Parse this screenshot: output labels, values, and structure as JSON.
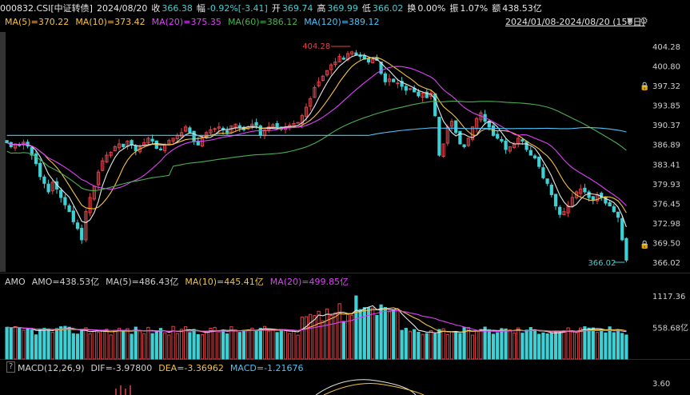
{
  "header": {
    "code": "000832.CSI[中证转债]",
    "date": "2024/08/20",
    "close_label": "收",
    "close": "366.38",
    "change_label": "幅",
    "change": "-0.92%[-3.41]",
    "open_label": "开",
    "open": "369.74",
    "high_label": "高",
    "high": "369.99",
    "low_label": "低",
    "low": "366.02",
    "turnover_label": "换",
    "turnover": "0.00%",
    "amplitude_label": "振",
    "amplitude": "1.07%",
    "amount_label": "额",
    "amount": "438.53亿",
    "date_range": "2024/01/08-2024/08/20 (150日)"
  },
  "ma_legend": [
    {
      "text": "MA(5)=370.22",
      "color": "#f5c242"
    },
    {
      "text": "MA(10)=373.42",
      "color": "#f5c242"
    },
    {
      "text": "MA(20)=375.35",
      "color": "#e040fb"
    },
    {
      "text": "MA(60)=386.12",
      "color": "#4caf50"
    },
    {
      "text": "MA(120)=389.12",
      "color": "#4fc3f7"
    }
  ],
  "vol_legend": [
    {
      "text": "AMO",
      "color": "#d0d0d0"
    },
    {
      "text": "AMO=438.53亿",
      "color": "#d0d0d0"
    },
    {
      "text": "MA(5)=486.43亿",
      "color": "#d0d0d0"
    },
    {
      "text": "MA(10)=445.41亿",
      "color": "#f5c242"
    },
    {
      "text": "MA(20)=499.85亿",
      "color": "#e040fb"
    }
  ],
  "macd_legend": [
    {
      "text": "MACD(12,26,9)",
      "color": "#d0d0d0"
    },
    {
      "text": "DIF=-3.97800",
      "color": "#d0d0d0"
    },
    {
      "text": "DEA=-3.36962",
      "color": "#f5c242"
    },
    {
      "text": "MACD=-1.21676",
      "color": "#4fc3f7"
    }
  ],
  "colors": {
    "up": "#e0434a",
    "down": "#3fd0d4",
    "ma5": "#e8e8e8",
    "ma10": "#f5c242",
    "ma20": "#e040fb",
    "ma60": "#4caf50",
    "ma120": "#4fc3f7"
  },
  "chart_data": {
    "type": "candlestick",
    "price_axis": [
      "404.28",
      "400.80",
      "397.32",
      "393.85",
      "390.37",
      "386.89",
      "383.41",
      "379.93",
      "376.45",
      "372.98",
      "369.50",
      "366.02"
    ],
    "price_ylim": [
      366.02,
      404.28
    ],
    "high_annotation": "404.28",
    "low_annotation": "366.02",
    "volume_axis": [
      "1117.36",
      "558.68亿"
    ],
    "volume_ylim": [
      0,
      1117.36
    ],
    "macd_axis": [
      "3.60"
    ],
    "closes": [
      387.2,
      386.5,
      387.0,
      386.8,
      387.3,
      386.6,
      385.0,
      383.5,
      381.2,
      380.0,
      378.5,
      380.2,
      379.0,
      377.5,
      376.2,
      375.0,
      373.2,
      372.0,
      370.0,
      375.0,
      377.5,
      379.5,
      382.0,
      384.0,
      385.0,
      385.5,
      386.5,
      387.0,
      386.5,
      387.5,
      386.8,
      385.8,
      386.4,
      387.2,
      388.0,
      387.5,
      386.2,
      386.0,
      386.8,
      387.6,
      388.0,
      388.5,
      389.0,
      390.0,
      389.0,
      387.5,
      386.8,
      388.0,
      389.0,
      389.5,
      389.7,
      390.0,
      389.5,
      389.0,
      390.2,
      390.5,
      390.0,
      389.5,
      390.0,
      390.5,
      390.3,
      388.5,
      389.5,
      390.0,
      390.4,
      390.0,
      389.6,
      390.0,
      390.3,
      390.6,
      390.8,
      392.0,
      393.5,
      395.0,
      397.0,
      398.0,
      399.0,
      400.0,
      401.0,
      401.5,
      402.5,
      402.0,
      403.0,
      403.3,
      402.8,
      402.5,
      402.0,
      401.5,
      402.0,
      401.8,
      399.5,
      398.0,
      398.5,
      398.0,
      397.8,
      397.2,
      396.5,
      396.8,
      396.2,
      395.5,
      396.0,
      395.2,
      396.0,
      392.0,
      385.0,
      387.0,
      390.0,
      391.0,
      389.0,
      387.0,
      386.5,
      388.0,
      390.0,
      391.5,
      392.5,
      391.0,
      390.0,
      388.5,
      388.0,
      387.5,
      386.0,
      386.5,
      387.0,
      388.0,
      387.5,
      386.0,
      385.0,
      384.5,
      383.0,
      381.0,
      380.0,
      378.0,
      376.0,
      374.5,
      375.0,
      376.0,
      377.5,
      378.5,
      379.0,
      378.5,
      377.5,
      377.0,
      378.0,
      377.5,
      376.5,
      376.0,
      375.0,
      374.0,
      370.0,
      366.4
    ]
  }
}
